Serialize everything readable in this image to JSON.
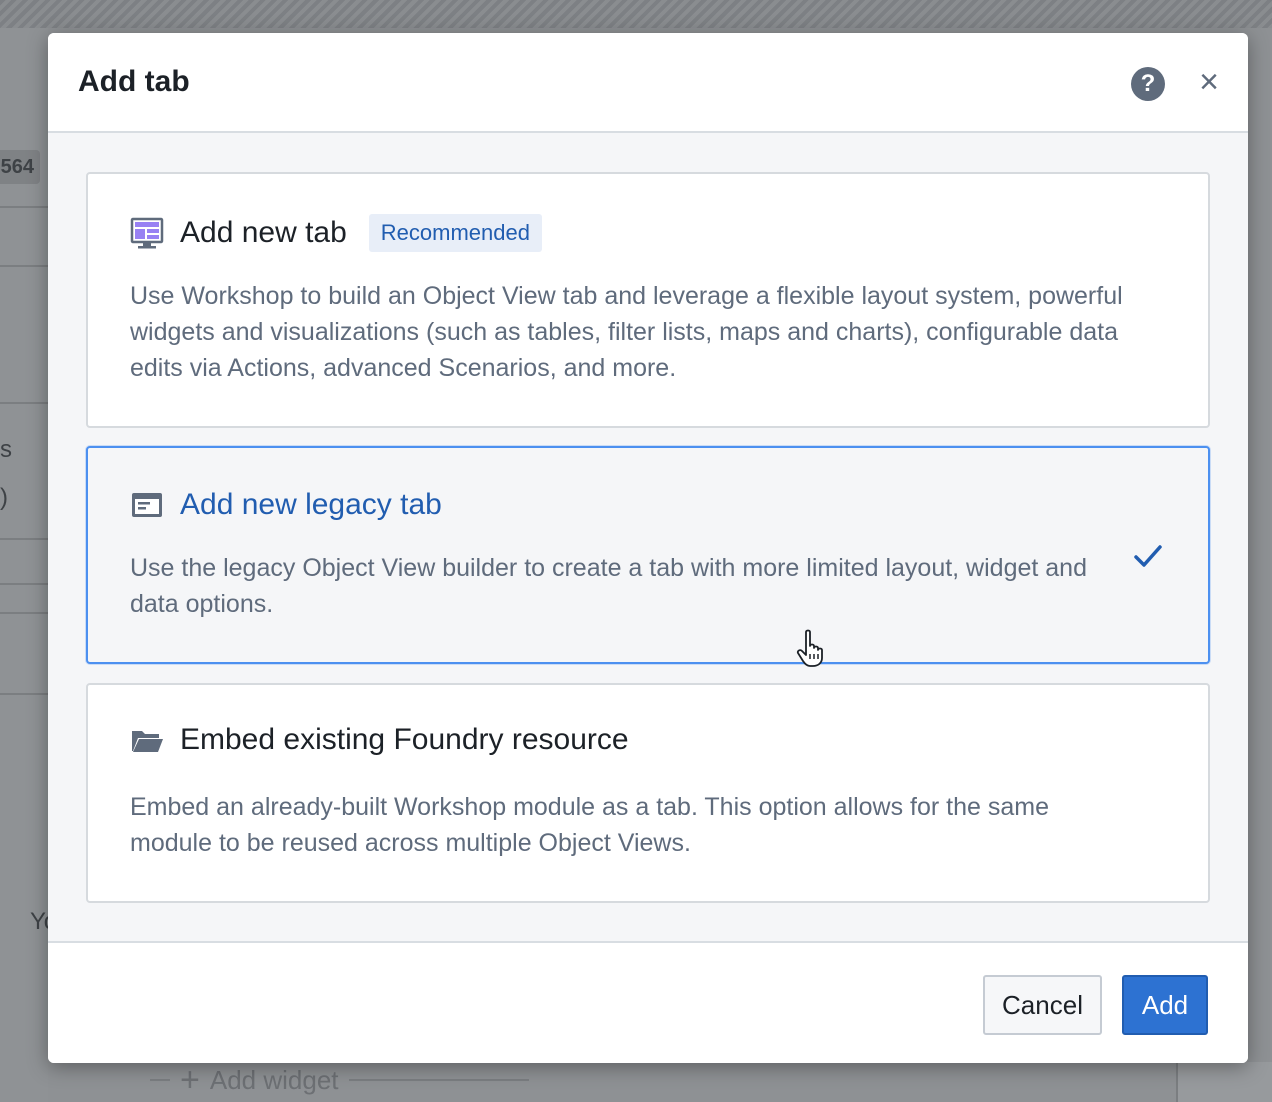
{
  "background": {
    "badge_text": "564",
    "fragment_a": "s",
    "fragment_b": ")",
    "fragment_c": "Yo",
    "add_widget_label": "Add widget"
  },
  "dialog": {
    "title": "Add tab",
    "help_icon": "?",
    "close_icon": "×",
    "options": [
      {
        "title": "Add new tab",
        "badge": "Recommended",
        "icon": "layout-icon",
        "description": "Use Workshop to build an Object View tab and leverage a flexible layout system, powerful widgets and visualizations (such as tables, filter lists, maps and charts), configurable data edits via Actions, advanced Scenarios, and more.",
        "selected": false
      },
      {
        "title": "Add new legacy tab",
        "icon": "application-icon",
        "description": "Use the legacy Object View builder to create a tab with more limited layout, widget and data options.",
        "selected": true
      },
      {
        "title": "Embed existing Foundry resource",
        "icon": "folder-open-icon",
        "description": "Embed an already-built Workshop module as a tab. This option allows for the same module to be reused across multiple Object Views.",
        "selected": false
      }
    ],
    "footer": {
      "cancel_label": "Cancel",
      "add_label": "Add"
    }
  },
  "colors": {
    "primary": "#2d72d2",
    "selected_border": "#4c90f0",
    "selected_title": "#215db0",
    "text_muted": "#5f6b7c",
    "badge_bg": "#e8eef8"
  }
}
